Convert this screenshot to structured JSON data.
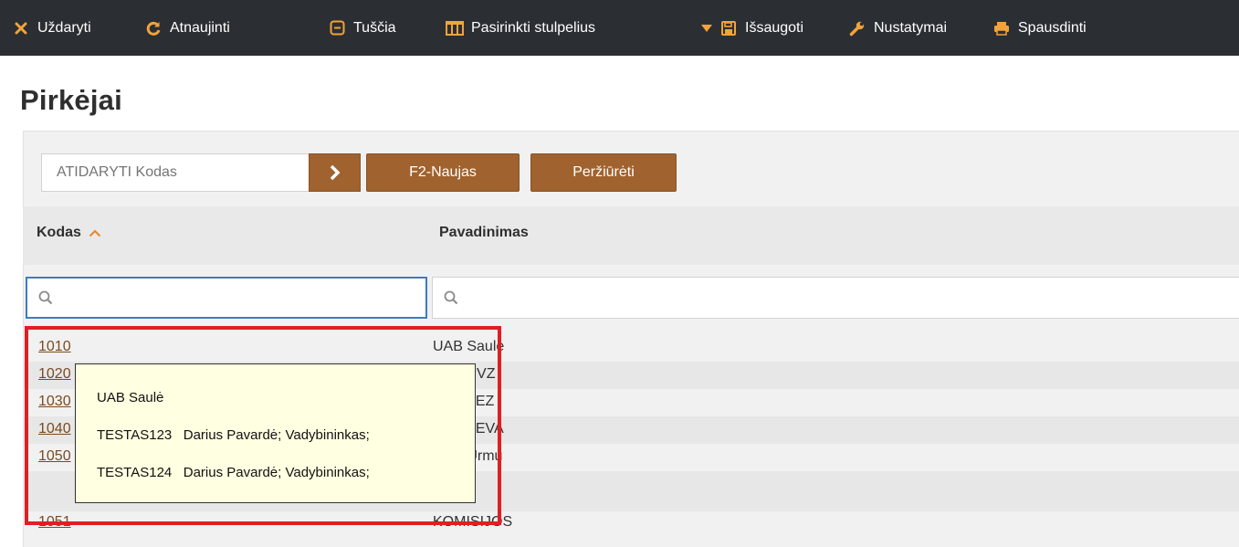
{
  "toolbar": {
    "items": [
      {
        "label": "Uždaryti",
        "icon": "close-icon"
      },
      {
        "label": "Atnaujinti",
        "icon": "refresh-icon"
      },
      {
        "label": "Tuščia",
        "icon": "empty-icon"
      },
      {
        "label": "Pasirinkti stulpelius",
        "icon": "columns-icon"
      },
      {
        "label": "Išsaugoti",
        "icon": "save-icon"
      },
      {
        "label": "Nustatymai",
        "icon": "wrench-icon"
      },
      {
        "label": "Spausdinti",
        "icon": "print-icon"
      }
    ]
  },
  "page": {
    "title": "Pirkėjai"
  },
  "actions": {
    "open_placeholder": "ATIDARYTI Kodas",
    "new_label": "F2-Naujas",
    "view_label": "Peržiūrėti"
  },
  "table": {
    "columns": [
      {
        "label": "Kodas",
        "sort": "ascending"
      },
      {
        "label": "Pavadinimas"
      }
    ],
    "rows": [
      {
        "code": "1010",
        "name": "UAB Saulė"
      },
      {
        "code": "1020",
        "name": "UAB PVZ"
      },
      {
        "code": "1030",
        "name": "UAB TEZ"
      },
      {
        "code": "1040",
        "name": "UAB TEVA"
      },
      {
        "code": "1050",
        "name": "UAB Urmu"
      },
      {
        "code": "1051",
        "name": "KOMISIJOS"
      }
    ]
  },
  "tooltip": {
    "title": "UAB Saulė",
    "lines": [
      "TESTAS123   Darius Pavardė; Vadybininkas;",
      "TESTAS124   Darius Pavardė; Vadybininkas;"
    ]
  },
  "colors": {
    "toolbar_bg": "#2b2f33",
    "accent_button": "#a0622e",
    "close_icon": "#f2a33a",
    "highlight_border": "#e01f25",
    "focus_border": "#3d7cc0",
    "tooltip_bg": "#ffffe1"
  }
}
